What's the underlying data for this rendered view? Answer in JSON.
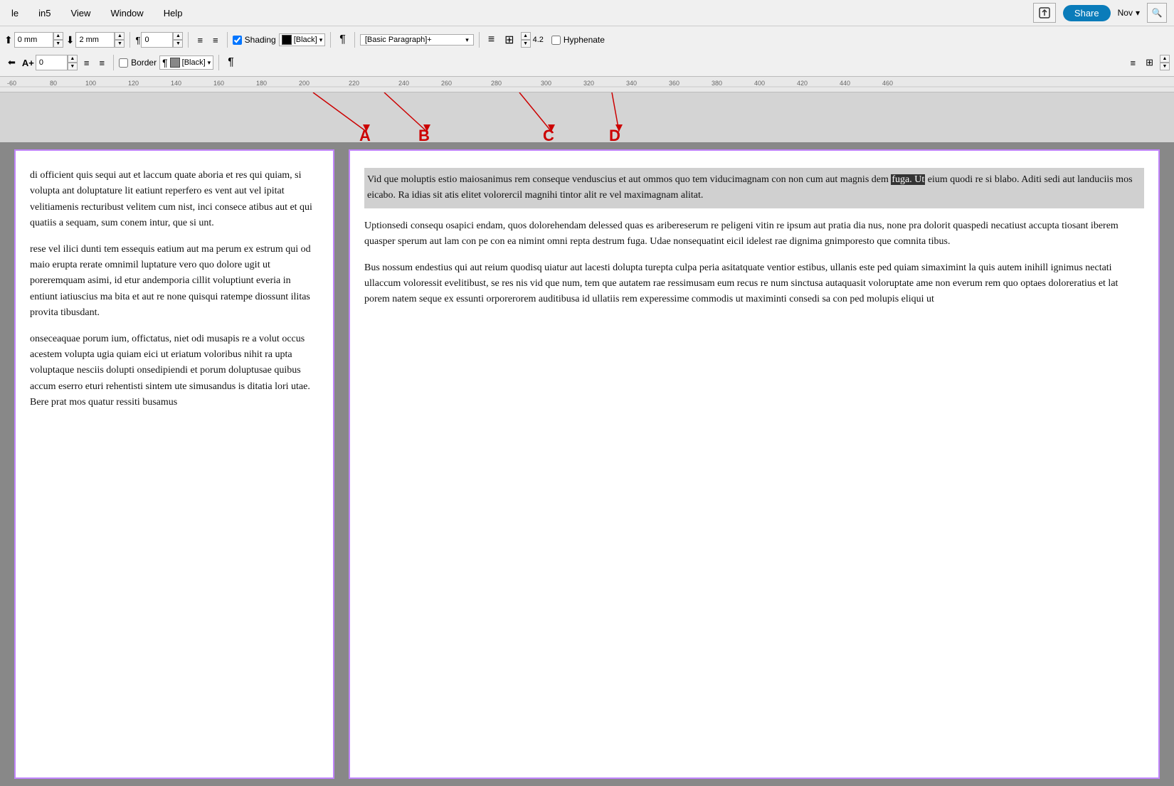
{
  "app": {
    "menu_items": [
      "le",
      "in5",
      "View",
      "Window",
      "Help"
    ],
    "share_label": "Share",
    "nav_month": "Nov",
    "search_icon": "🔍"
  },
  "toolbar": {
    "row1": {
      "space_before_label": "0 mm",
      "space_after_label": "2 mm",
      "value1": "0",
      "shading_checked": true,
      "shading_label": "Shading",
      "color_black": "[Black]",
      "paragraph_style": "[Basic Paragraph]+",
      "align_icon1": "≡",
      "align_icon2": "⊞",
      "hyphenate_label": "Hyphenate",
      "hyphenate_checked": false
    },
    "row2": {
      "size_label": "A+",
      "value2": "0",
      "border_checked": false,
      "border_label": "Border",
      "color_black2": "[Black]",
      "show_hidden_icon": "¶"
    }
  },
  "ruler": {
    "marks": [
      "-60",
      "80",
      "100",
      "120",
      "140",
      "160",
      "180",
      "200",
      "220",
      "240",
      "260",
      "280",
      "300",
      "320",
      "340",
      "360",
      "380",
      "400",
      "420",
      "440",
      "460"
    ]
  },
  "annotations": {
    "labels": [
      "A",
      "B",
      "C",
      "D"
    ]
  },
  "left_page": {
    "paragraphs": [
      "di officient quis sequi aut et laccum quate aboria et res qui quiam, si volupta ant doluptature lit eatiunt reperfero es vent aut vel ipitat velitiamenis recturibust velitem cum nist, inci consece atibus aut et qui quatiis a sequam, sum conem intur, que si unt.",
      "rese vel ilici dunti tem essequis eatium aut ma perum ex estrum qui od maio erupta rerate omnimil luptature vero quo dolore ugit ut poreremquam asimi, id etur andemporia cillit voluptiunt everia in entiunt iatiuscius ma bita et aut re none quisqui ratempe diossunt ilitas provita tibusdant.",
      "onseceaquae porum ium, offictatus, niet odi musapis re a volut occus acestem volupta ugia quiam eici ut eriatum voloribus nihit ra upta voluptaque nesciis dolupti onsedipiendi et porum doluptusae quibus accum eserro eturi rehentisti sintem ute simusandus is ditatia lori utae. Bere prat mos quatur ressiti busamus"
    ]
  },
  "right_page": {
    "paragraphs": [
      "Vid que moluptis estio maiosanimus rem conseque venduscius et aut ommos quo tem viducimagnam con non cum aut magnis dem fuga. Ut eium quodi re si blabo. Aditi sedi aut landuciis mos eicabo. Ra idias sit atis elitet volorercil magnihi tintor alit re vel maximagnam alitat.",
      "Uptionsedi consequ osapici endam, quos dolorehendam delessed quas es aribereserum re peligeni vitin re ipsum aut pratia dia nus, none pra dolorit quaspedi necatiust accupta tiosant iberem quasper sperum aut lam con pe con ea nimint omni repta destrum fuga. Udae nonsequatint eicil idelest rae dignima gnimporesto que comnita tibus.",
      "Bus nossum endestius qui aut reium quodisq uiatur aut lacesti dolupta turepta culpa peria asitatquate ventior estibus, ullanis este ped quiam simaximint la quis autem inihill ignimus nectati ullaccum voloressit evelitibust, se res nis vid que num, tem que autatem rae ressimusam eum recus re num sinctusa autaquasit voloruptate ame non everum rem quo optaes doloreratius et lat porem natem seque ex essunti orporerorem auditibusa id ullatiis rem experessime commodis ut maximinti consedi sa con ped molupis eliqui ut"
    ],
    "selected_text": "fuga. Ut"
  }
}
